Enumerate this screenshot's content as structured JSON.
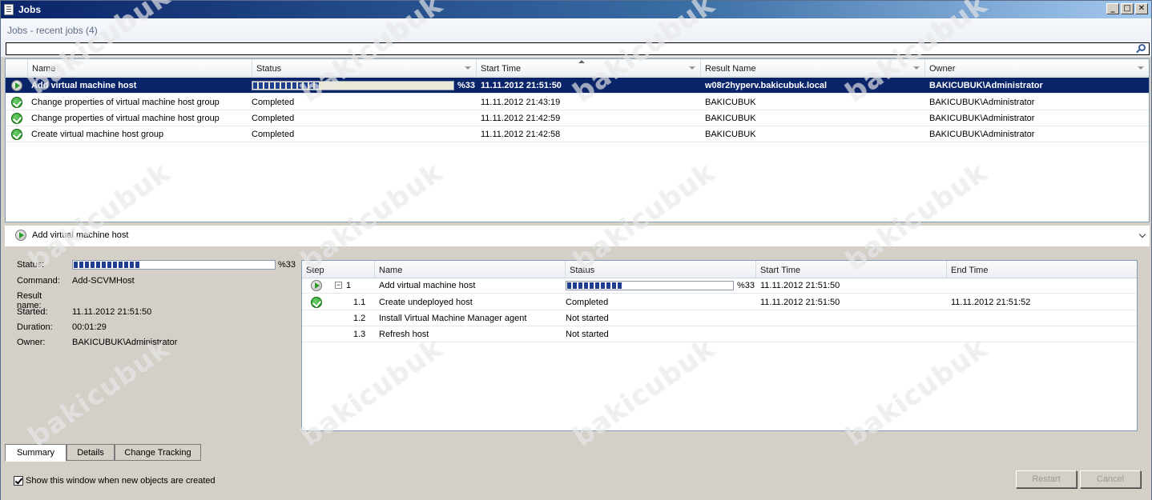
{
  "window": {
    "title": "Jobs",
    "controls": {
      "minimize": "_",
      "maximize": "□",
      "close": "✕"
    }
  },
  "header": {
    "subtitle": "Jobs - recent jobs (4)",
    "search_value": ""
  },
  "jobs_table": {
    "columns": [
      "Name",
      "Status",
      "Start Time",
      "Result Name",
      "Owner"
    ],
    "sorted_column": "Start Time",
    "rows": [
      {
        "icon": "running-icon",
        "name": "Add virtual machine host",
        "status": "",
        "progress_label": "%33",
        "progress": 0.33,
        "start_time": "11.11.2012 21:51:50",
        "result_name": "w08r2hyperv.bakicubuk.local",
        "owner": "BAKICUBUK\\Administrator",
        "selected": true
      },
      {
        "icon": "completed-icon",
        "name": "Change properties of virtual machine host group",
        "status": "Completed",
        "start_time": "11.11.2012 21:43:19",
        "result_name": "BAKICUBUK",
        "owner": "BAKICUBUK\\Administrator",
        "selected": false
      },
      {
        "icon": "completed-icon",
        "name": "Change properties of virtual machine host group",
        "status": "Completed",
        "start_time": "11.11.2012 21:42:59",
        "result_name": "BAKICUBUK",
        "owner": "BAKICUBUK\\Administrator",
        "selected": false
      },
      {
        "icon": "completed-icon",
        "name": "Create virtual machine host group",
        "status": "Completed",
        "start_time": "11.11.2012 21:42:58",
        "result_name": "BAKICUBUK",
        "owner": "BAKICUBUK\\Administrator",
        "selected": false
      }
    ]
  },
  "detail": {
    "title": "Add virtual machine host",
    "properties": {
      "status_label": "Status:",
      "status_progress_label": "%33",
      "status_progress": 0.33,
      "command_label": "Command:",
      "command": "Add-SCVMHost",
      "result_name_label": "Result name:",
      "result_name": "",
      "started_label": "Started:",
      "started": "11.11.2012 21:51:50",
      "duration_label": "Duration:",
      "duration": "00:01:29",
      "owner_label": "Owner:",
      "owner": "BAKICUBUK\\Administrator"
    },
    "steps_table": {
      "columns": [
        "Step",
        "Name",
        "Status",
        "Start Time",
        "End Time"
      ],
      "rows": [
        {
          "icon": "running-icon",
          "expander": "−",
          "step": "1",
          "name": "Add virtual machine host",
          "progress_label": "%33",
          "progress": 0.33,
          "status": "",
          "start_time": "11.11.2012 21:51:50",
          "end_time": ""
        },
        {
          "icon": "completed-icon",
          "step": "1.1",
          "name": "Create undeployed host",
          "status": "Completed",
          "start_time": "11.11.2012 21:51:50",
          "end_time": "11.11.2012 21:51:52"
        },
        {
          "icon": "",
          "step": "1.2",
          "name": "Install Virtual Machine Manager agent",
          "status": "Not started",
          "start_time": "",
          "end_time": ""
        },
        {
          "icon": "",
          "step": "1.3",
          "name": "Refresh host",
          "status": "Not started",
          "start_time": "",
          "end_time": ""
        }
      ]
    }
  },
  "tabs": [
    {
      "label": "Summary",
      "active": true
    },
    {
      "label": "Details",
      "active": false
    },
    {
      "label": "Change Tracking",
      "active": false
    }
  ],
  "footer": {
    "show_window_checkbox_label": "Show this window when new objects are created",
    "show_window_checked": true,
    "restart_label": "Restart",
    "cancel_label": "Cancel"
  },
  "watermark_text": "bakicubuk"
}
